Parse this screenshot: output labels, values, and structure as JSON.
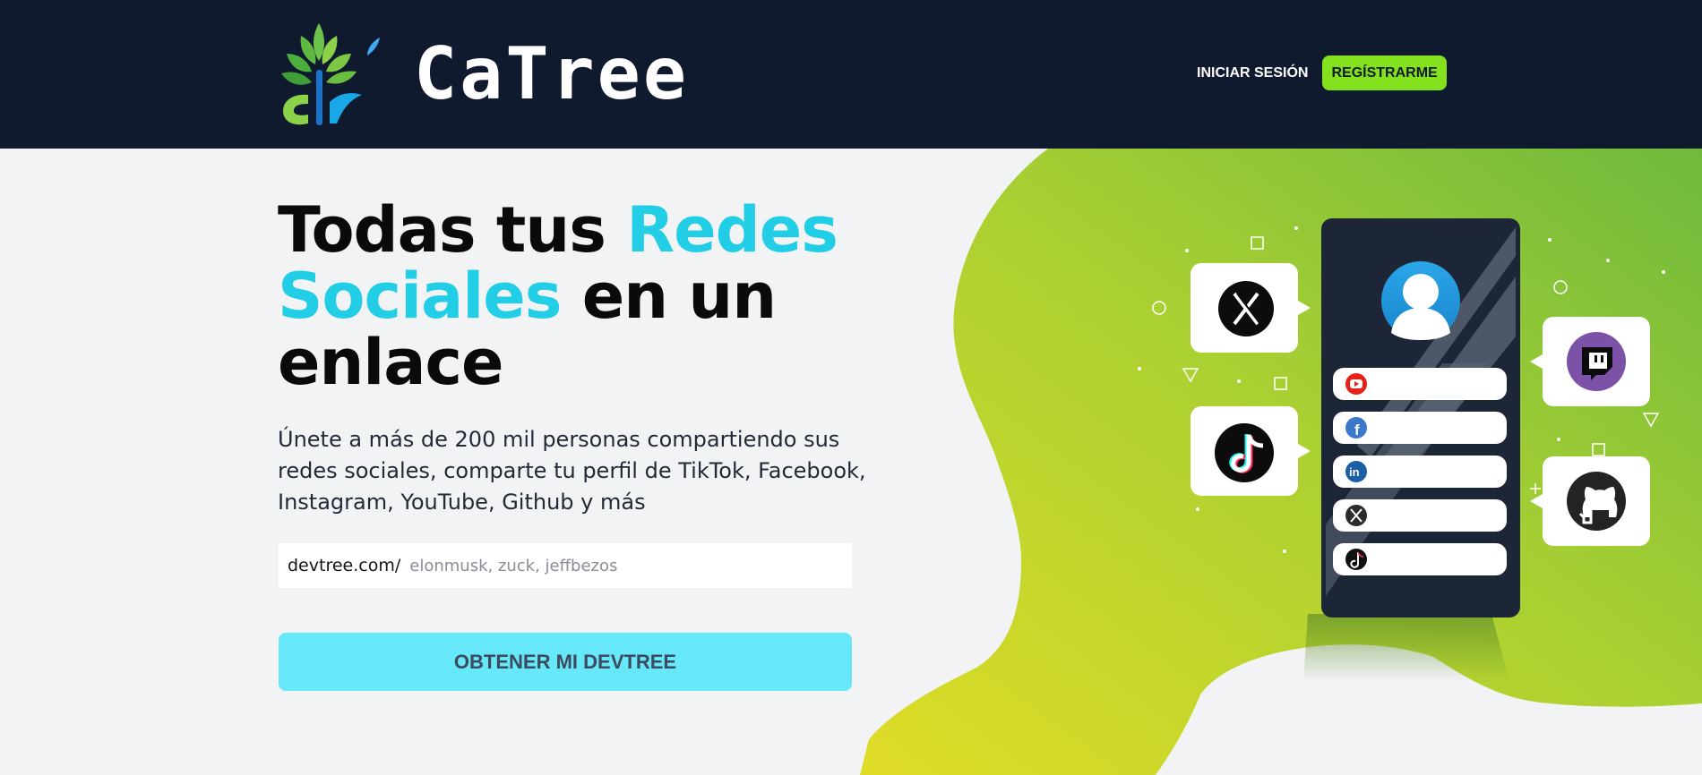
{
  "header": {
    "brand_name": "CaTree",
    "nav": {
      "login_label": "Iniciar Sesión",
      "register_label": "Regístrarme"
    }
  },
  "hero": {
    "title_part1": "Todas tus ",
    "title_accent": "Redes Sociales",
    "title_part2": " en un enlace",
    "description": "Únete a más de 200 mil personas compartiendo sus redes sociales, comparte tu perfil de TikTok, Facebook, Instagram, YouTube, Github y más",
    "search_prefix": "devtree.com/",
    "search_placeholder": "elonmusk, zuck, jeffbezos",
    "search_value": "",
    "cta_label": "Obtener mi DevTree"
  },
  "colors": {
    "header_bg": "#101a2e",
    "accent_cyan": "#22cde6",
    "register_green": "#84e11d",
    "cta_bg": "#67e8f9",
    "blob_start": "#e0dc26",
    "blob_end": "#76bc3a"
  },
  "illustration": {
    "icons": [
      "x-icon",
      "tiktok-icon",
      "twitch-icon",
      "github-icon",
      "user-avatar-icon",
      "youtube-icon",
      "facebook-icon",
      "linkedin-icon",
      "x-icon",
      "tiktok-icon"
    ]
  }
}
